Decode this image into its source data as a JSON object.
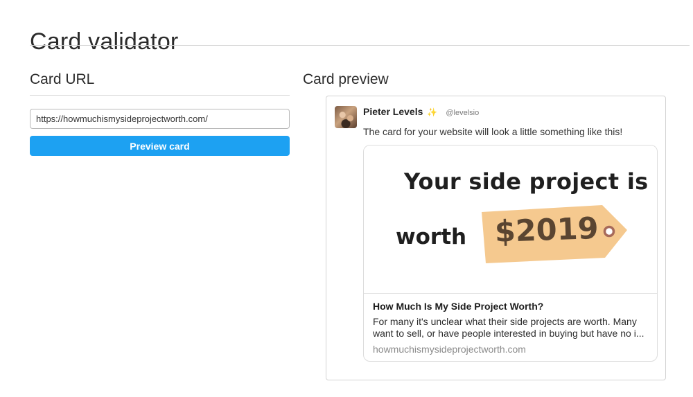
{
  "page": {
    "title": "Card validator"
  },
  "url_section": {
    "heading": "Card URL",
    "input_value": "https://howmuchismysideprojectworth.com/",
    "button_label": "Preview card"
  },
  "preview_section": {
    "heading": "Card preview",
    "tweet": {
      "user_name": "Pieter Levels",
      "emoji": "✨",
      "handle": "@levelsio",
      "text": "The card for your website will look a little something like this!"
    },
    "card": {
      "image_headline": "Your side project is",
      "image_worth": "worth",
      "image_price": "$2019",
      "title": "How Much Is My Side Project Worth?",
      "description": "For many it's unclear what their side projects are worth. Many want to sell, or have people interested in buying but have no i...",
      "domain": "howmuchismysideprojectworth.com"
    }
  },
  "colors": {
    "button": "#1da1f2",
    "price_tag": "#f5c98f",
    "price_text": "#5a4531"
  }
}
